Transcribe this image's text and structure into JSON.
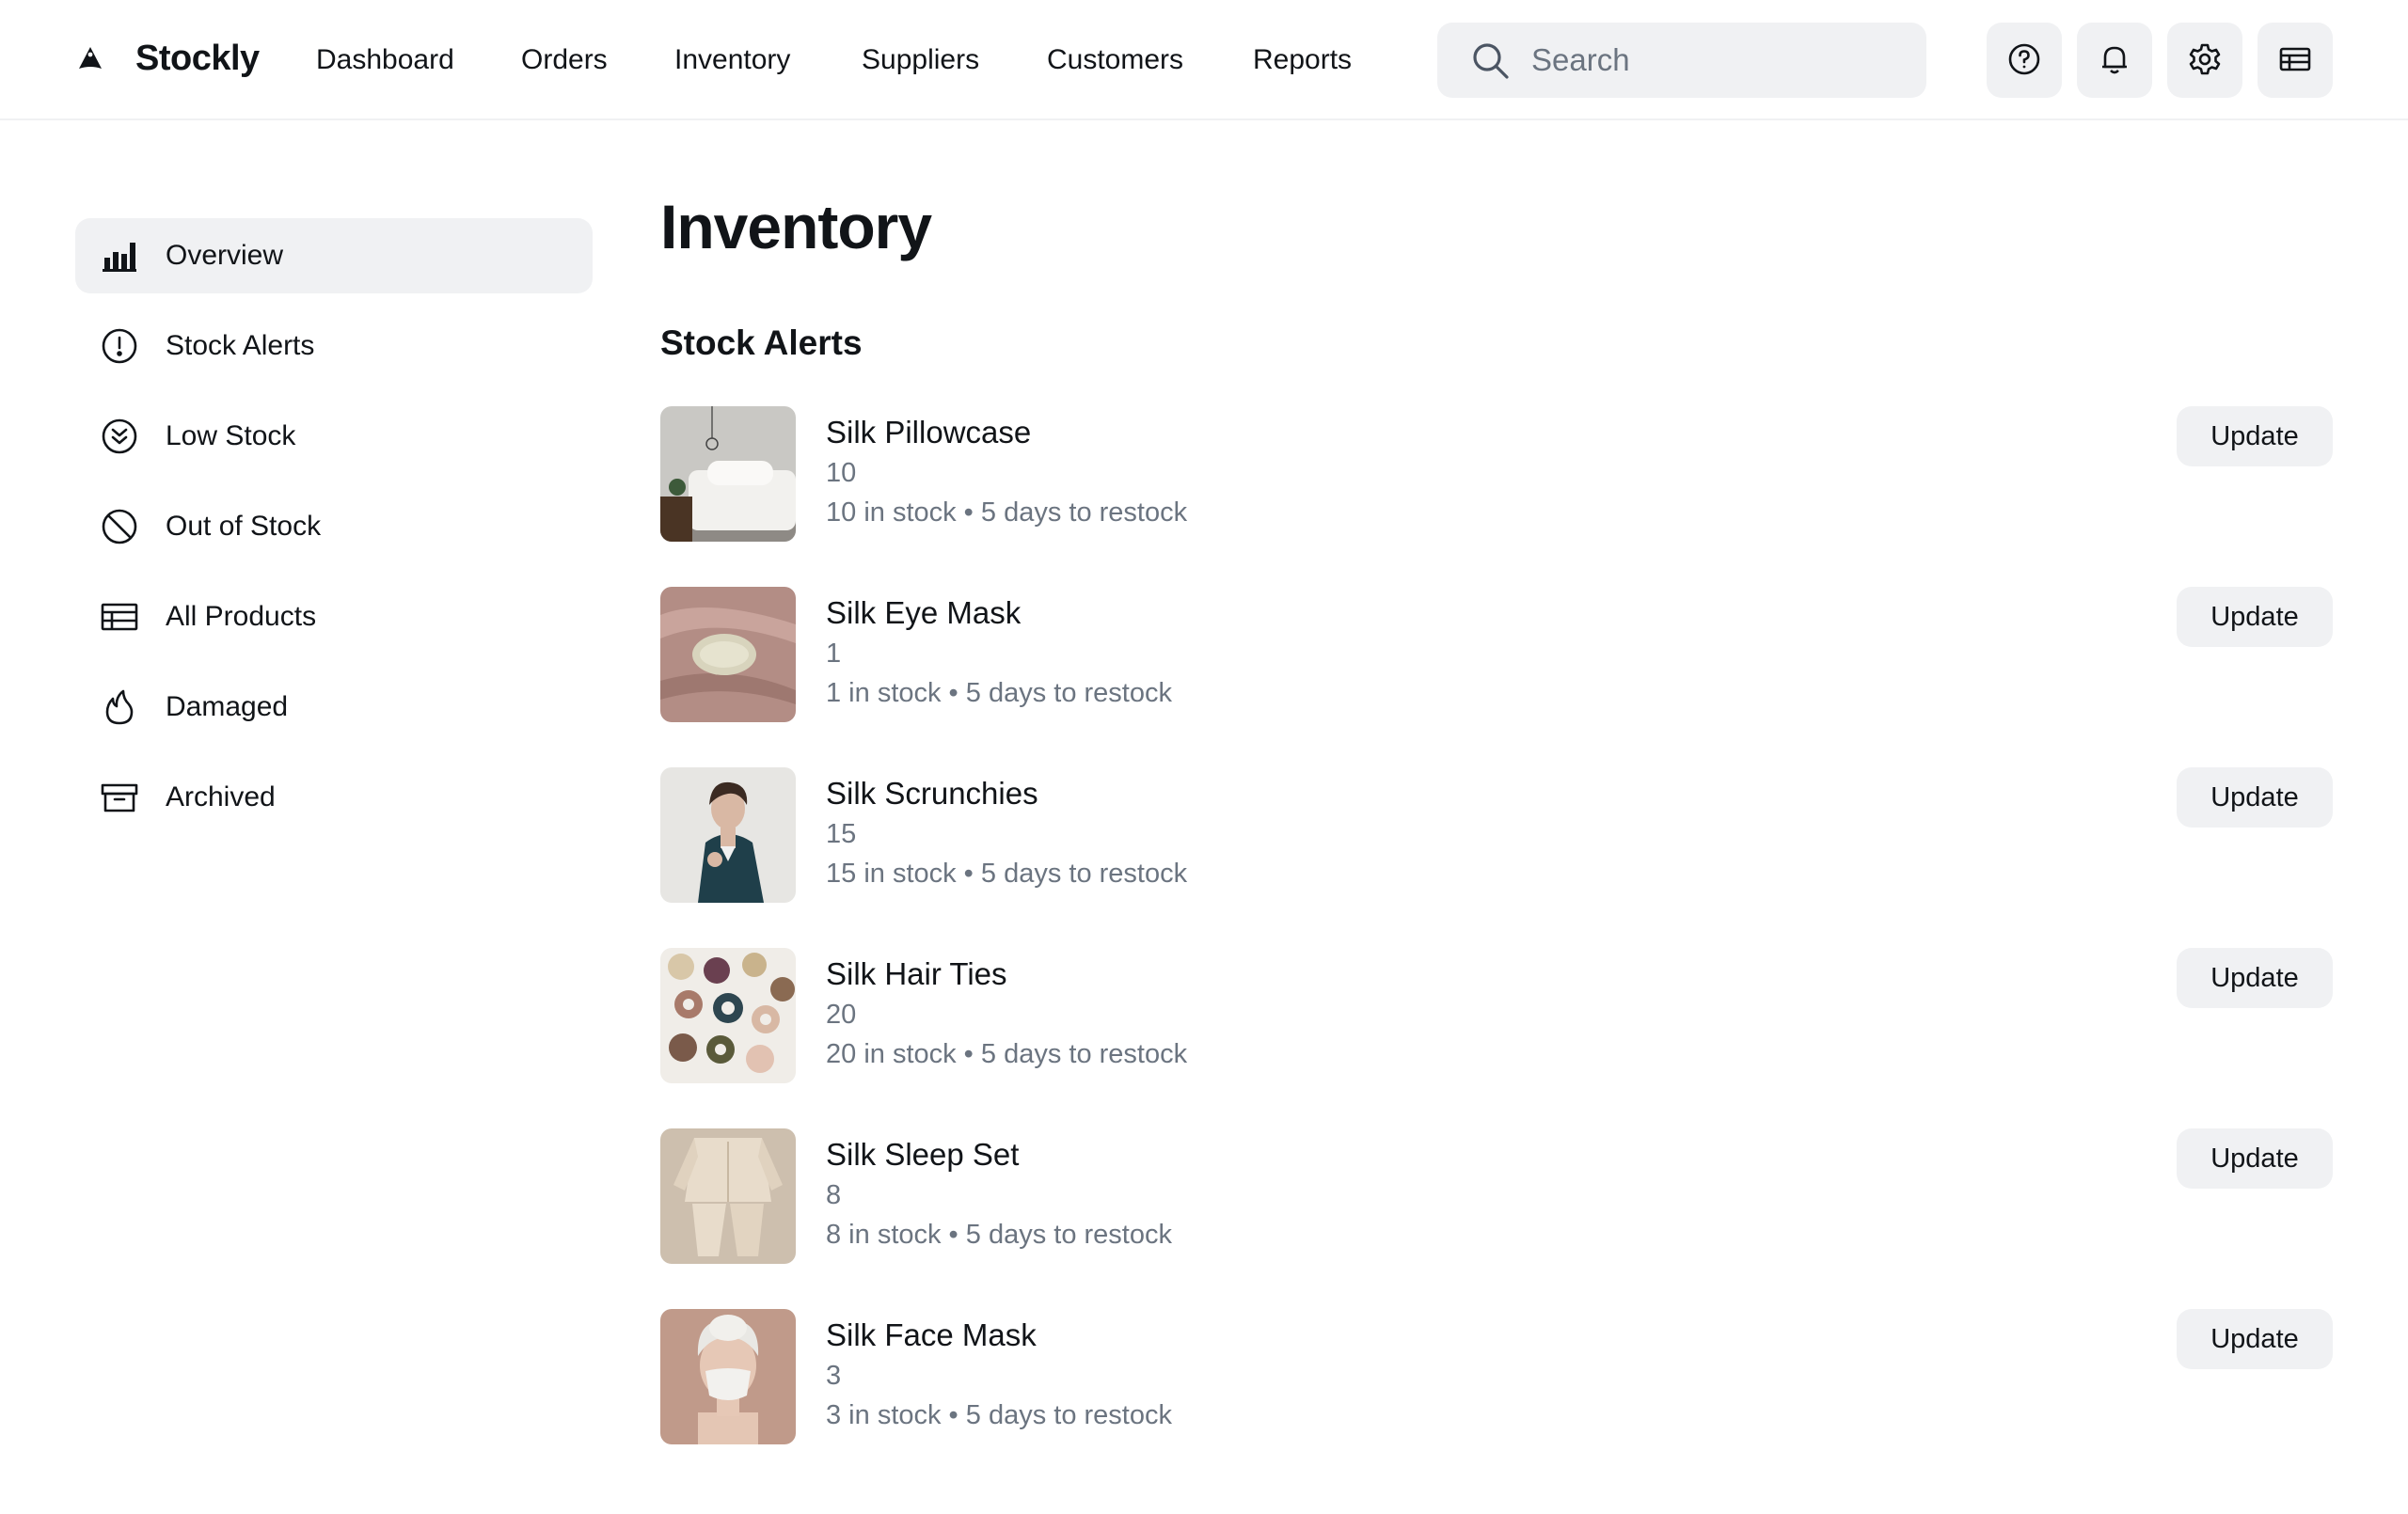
{
  "app": {
    "name": "Stockly"
  },
  "nav": {
    "items": [
      "Dashboard",
      "Orders",
      "Inventory",
      "Suppliers",
      "Customers",
      "Reports"
    ]
  },
  "search": {
    "placeholder": "Search",
    "value": ""
  },
  "header_icons": [
    "help-icon",
    "bell-icon",
    "gear-icon",
    "table-icon"
  ],
  "sidebar": {
    "items": [
      {
        "label": "Overview",
        "icon": "bar-chart-icon",
        "active": true
      },
      {
        "label": "Stock Alerts",
        "icon": "alert-circle-icon"
      },
      {
        "label": "Low Stock",
        "icon": "chevrons-down-circle-icon"
      },
      {
        "label": "Out of Stock",
        "icon": "ban-icon"
      },
      {
        "label": "All Products",
        "icon": "table-icon"
      },
      {
        "label": "Damaged",
        "icon": "flame-icon"
      },
      {
        "label": "Archived",
        "icon": "archive-icon"
      }
    ]
  },
  "main": {
    "title": "Inventory",
    "section_title": "Stock Alerts",
    "products": [
      {
        "name": "Silk Pillowcase",
        "qty": "10",
        "meta": "10 in stock • 5 days to restock",
        "action": "Update"
      },
      {
        "name": "Silk Eye Mask",
        "qty": "1",
        "meta": "1 in stock • 5 days to restock",
        "action": "Update"
      },
      {
        "name": "Silk Scrunchies",
        "qty": "15",
        "meta": "15 in stock • 5 days to restock",
        "action": "Update"
      },
      {
        "name": "Silk Hair Ties",
        "qty": "20",
        "meta": "20 in stock • 5 days to restock",
        "action": "Update"
      },
      {
        "name": "Silk Sleep Set",
        "qty": "8",
        "meta": "8 in stock • 5 days to restock",
        "action": "Update"
      },
      {
        "name": "Silk Face Mask",
        "qty": "3",
        "meta": "3 in stock • 5 days to restock",
        "action": "Update"
      }
    ]
  },
  "colors": {
    "text": "#111418",
    "muted": "#6b7480",
    "surface": "#f0f1f3",
    "background": "#ffffff"
  }
}
